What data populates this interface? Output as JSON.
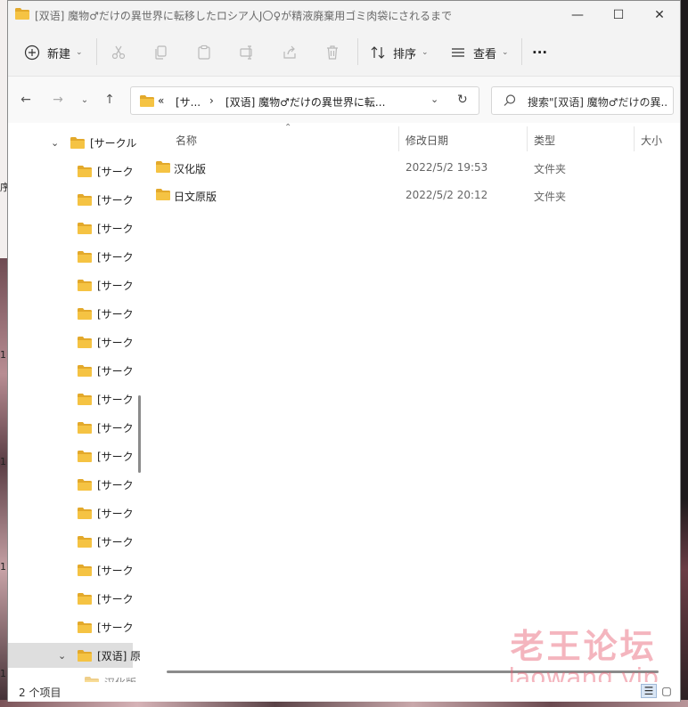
{
  "background": {
    "left_text": [
      "序",
      "1",
      "1",
      "1",
      "1"
    ]
  },
  "window": {
    "title": "[双语] 魔物♂だけの異世界に転移したロシア人J〇♀が精液廃棄用ゴミ肉袋にされるまで",
    "controls": {
      "minimize": "—",
      "maximize": "☐",
      "close": "✕"
    }
  },
  "commandbar": {
    "new_label": "新建",
    "sort_label": "排序",
    "view_label": "查看",
    "more_label": "···"
  },
  "navbar": {
    "address": {
      "prefix": "«",
      "segment1": "[サ...",
      "separator": "›",
      "segment2": "[双语] 魔物♂だけの異世界に転..."
    },
    "search_placeholder": "搜索\"[双语] 魔物♂だけの異..."
  },
  "sidebar": {
    "parent_label": "[サークル",
    "items": [
      "[サーク",
      "[サーク",
      "[サーク",
      "[サーク",
      "[サーク",
      "[サーク",
      "[サーク",
      "[サーク",
      "[サーク",
      "[サーク",
      "[サーク",
      "[サーク",
      "[サーク",
      "[サーク",
      "[サーク",
      "[サーク",
      "[サーク"
    ],
    "selected_label": "[双语] 原",
    "child_label": "汉化版"
  },
  "columns": {
    "name": "名称",
    "modified": "修改日期",
    "type": "类型",
    "size": "大小"
  },
  "files": [
    {
      "name": "汉化版",
      "modified": "2022/5/2 19:53",
      "type": "文件夹"
    },
    {
      "name": "日文原版",
      "modified": "2022/5/2 20:12",
      "type": "文件夹"
    }
  ],
  "status": {
    "item_count": "2 个项目"
  },
  "watermark": {
    "cn": "老王论坛",
    "en": "laowang.vip"
  },
  "colors": {
    "folder": "#f5c343",
    "folder_dark": "#e3a92b",
    "selected": "#dedede",
    "watermark": "#e65a6e"
  }
}
